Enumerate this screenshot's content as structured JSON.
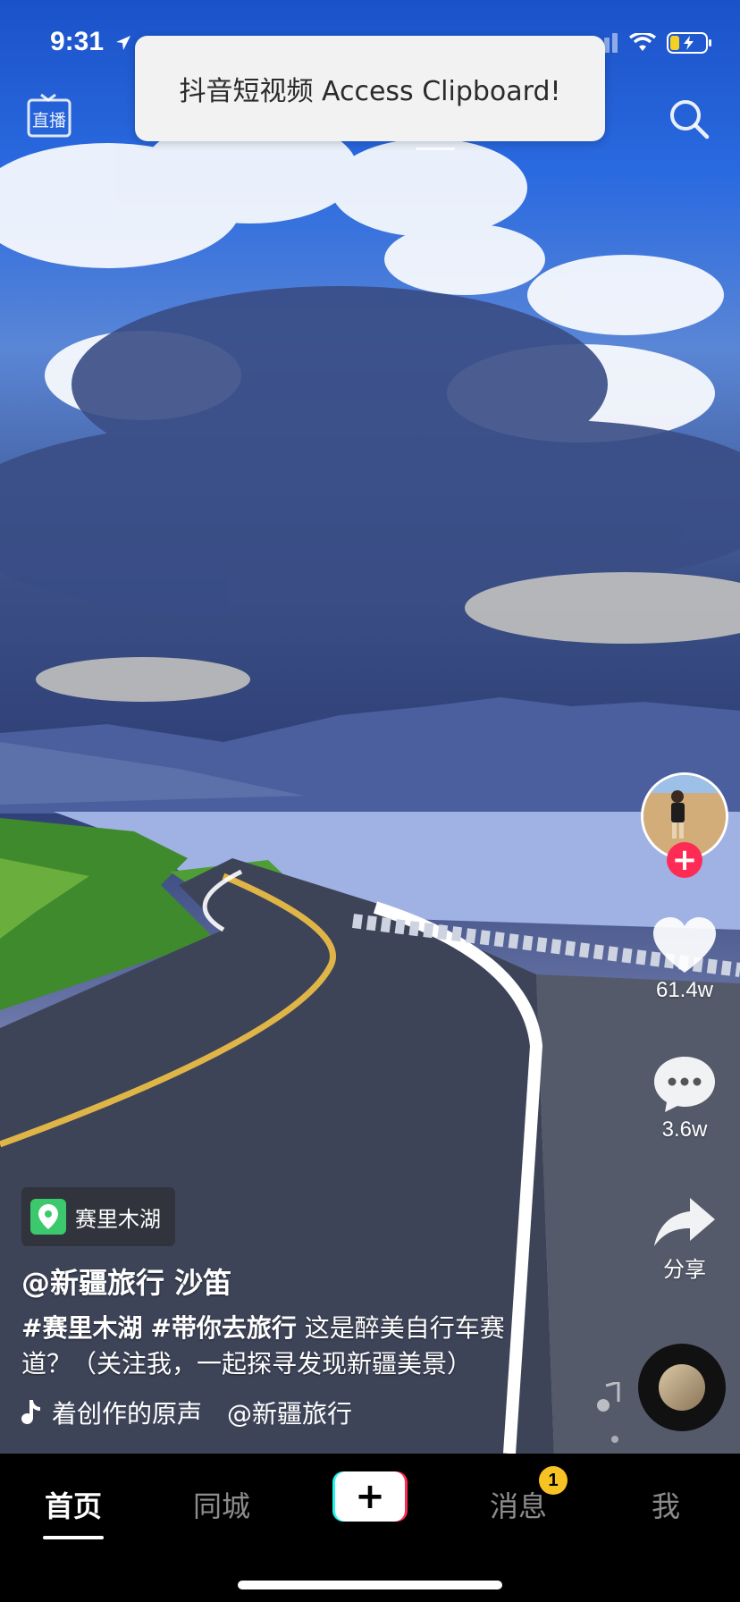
{
  "status_bar": {
    "time": "9:31"
  },
  "top_bar": {
    "live_label": "直播"
  },
  "toast": {
    "message": "抖音短视频 Access Clipboard!"
  },
  "actions": {
    "likes": "61.4w",
    "comments": "3.6w",
    "share_label": "分享"
  },
  "video": {
    "location": "赛里木湖",
    "author": "@新疆旅行 沙笛",
    "tag1": "#赛里木湖",
    "tag2": "#带你去旅行",
    "caption": " 这是醉美自行车赛道？（关注我，一起探寻发现新疆美景）",
    "sound": "着创作的原声　@新疆旅行"
  },
  "tabbar": {
    "tabs": [
      {
        "label": "首页",
        "active": true
      },
      {
        "label": "同城",
        "active": false
      },
      {
        "label": "消息",
        "active": false
      },
      {
        "label": "我",
        "active": false
      }
    ],
    "create_label": "+",
    "messages_badge": "1"
  },
  "colors": {
    "accent_red": "#fe2c55",
    "accent_cyan": "#25f4ee",
    "badge_yellow": "#f7c224",
    "location_green": "#3cc96e"
  },
  "icons": [
    "location-arrow-icon",
    "signal-icon",
    "wifi-icon",
    "battery-charging-icon",
    "live-icon",
    "search-icon",
    "heart-icon",
    "comment-icon",
    "share-icon",
    "pin-icon",
    "music-note-icon"
  ]
}
